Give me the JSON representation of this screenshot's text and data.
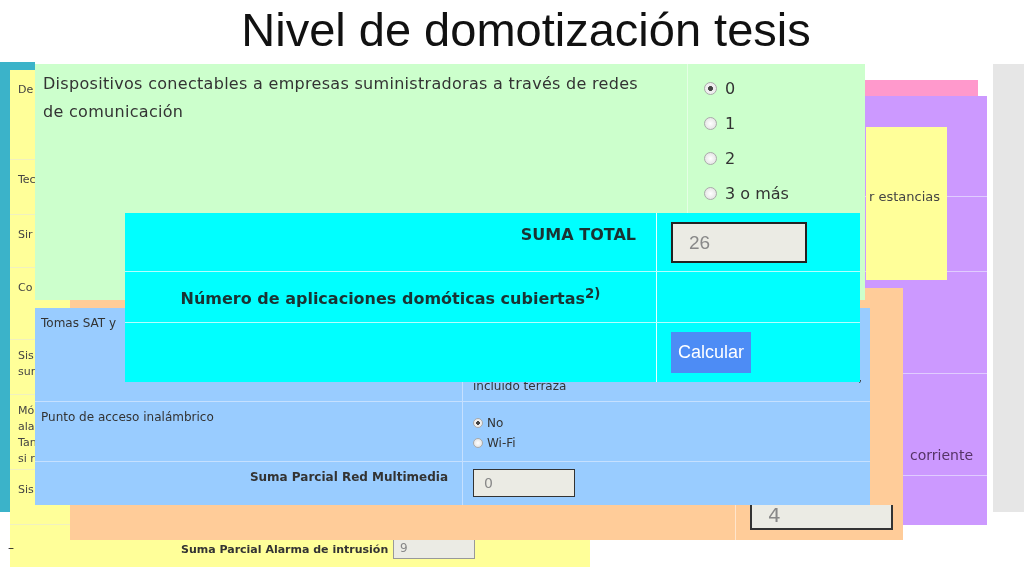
{
  "title": "Nivel de domotización tesis",
  "alarm_form": {
    "rows": [
      {
        "lines": [
          "De"
        ]
      },
      {
        "lines": [
          "Tec"
        ]
      },
      {
        "lines": [
          "Sir"
        ]
      },
      {
        "lines": [
          "Co"
        ]
      },
      {
        "lines": [
          "Sis",
          "sur"
        ]
      },
      {
        "lines": [
          "Mó",
          "ala",
          "Tan",
          "si r"
        ]
      },
      {
        "lines": [
          "Sis"
        ]
      }
    ],
    "mark": "–",
    "subtotal": {
      "label": "Suma Parcial Alarma de intrusión",
      "value": "9"
    }
  },
  "power_form": {
    "text": "corriente"
  },
  "rooms_note": {
    "text": "r estancias"
  },
  "programs_form": {
    "subtotal": {
      "value": "4"
    }
  },
  "multimedia_form": {
    "first_row": {
      "label": "Tomas SAT y",
      "detail": "incluido terraza",
      "trailing": ","
    },
    "access_point": {
      "label": "Punto de acceso inalámbrico",
      "options": [
        {
          "label": "No",
          "selected": true
        },
        {
          "label": "Wi-Fi",
          "selected": false
        }
      ]
    },
    "subtotal": {
      "label": "Suma Parcial Red Multimedia",
      "value": "0"
    }
  },
  "question": {
    "text": "Dispositivos conectables a empresas suministradoras a través de redes de comunicación",
    "options": [
      {
        "label": "0",
        "selected": true
      },
      {
        "label": "1",
        "selected": false
      },
      {
        "label": "2",
        "selected": false
      },
      {
        "label": "3 o más",
        "selected": false
      }
    ]
  },
  "totals": {
    "total_label": "SUMA TOTAL",
    "total_value": "26",
    "apps_label": "Número de aplicaciones domóticas cubiertas$^{2)}$",
    "button": "Calcular"
  }
}
